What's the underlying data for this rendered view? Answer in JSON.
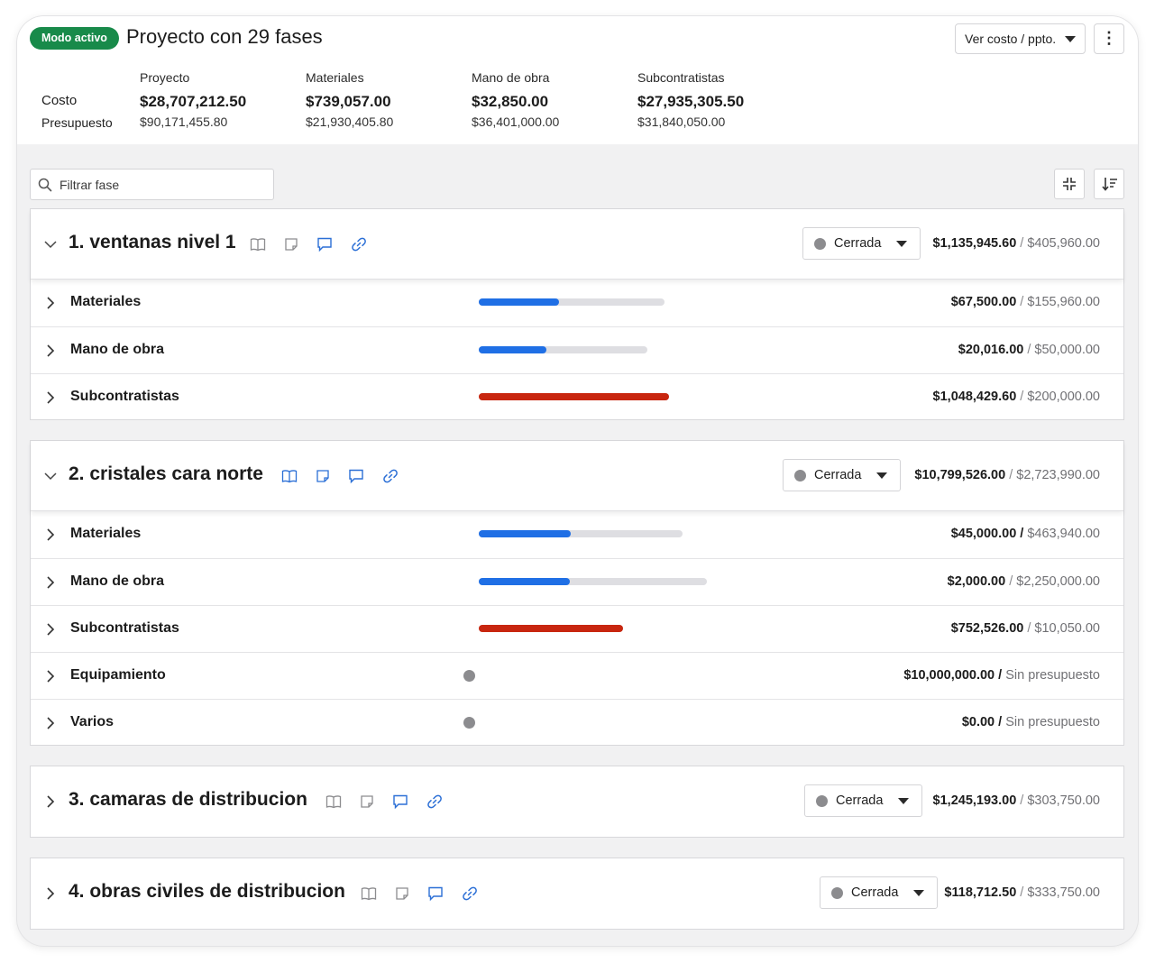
{
  "header": {
    "mode_badge": "Modo activo",
    "title": "Proyecto con 29 fases",
    "view_select": "Ver costo / ppto.",
    "more_icon": "kebab-vertical-icon"
  },
  "summary": {
    "cost_label": "Costo",
    "budget_label": "Presupuesto",
    "columns": [
      {
        "heading": "Proyecto",
        "cost": "$28,707,212.50",
        "budget": "$90,171,455.80"
      },
      {
        "heading": "Materiales",
        "cost": "$739,057.00",
        "budget": "$21,930,405.80"
      },
      {
        "heading": "Mano de obra",
        "cost": "$32,850.00",
        "budget": "$36,401,000.00"
      },
      {
        "heading": "Subcontratistas",
        "cost": "$27,935,305.50",
        "budget": "$31,840,050.00"
      }
    ]
  },
  "toolbar": {
    "filter_placeholder": "Filtrar fase",
    "collapse_icon": "collapse-all-icon",
    "sort_icon": "sort-icon"
  },
  "colors": {
    "active_badge": "#188a4a",
    "progress_blue": "#1f6fe5",
    "progress_over": "#c8260f",
    "icon_active": "#2b6fd6",
    "icon_inactive": "#8c8c8f"
  },
  "phases": [
    {
      "title": "1. ventanas nivel 1",
      "expanded": true,
      "status": "Cerrada",
      "cost": "$1,135,945.60",
      "separator": " / ",
      "budget": "$405,960.00",
      "icons_active": {
        "book": false,
        "note": false,
        "comment": true,
        "link": true
      },
      "rows": [
        {
          "label": "Materiales",
          "cost": "$67,500.00",
          "separator": " / ",
          "budget": "$155,960.00",
          "progress": 0.43,
          "over_budget": false
        },
        {
          "label": "Mano de obra",
          "cost": "$20,016.00",
          "separator": " / ",
          "budget": "$50,000.00",
          "progress": 0.4,
          "over_budget": false
        },
        {
          "label": "Subcontratistas",
          "cost": "$1,048,429.60",
          "separator": " / ",
          "budget": "$200,000.00",
          "progress": 1.0,
          "over_budget": true
        }
      ]
    },
    {
      "title": "2. cristales cara norte",
      "expanded": true,
      "status": "Cerrada",
      "cost": "$10,799,526.00",
      "separator": " / ",
      "budget": "$2,723,990.00",
      "icons_active": {
        "book": true,
        "note": true,
        "comment": true,
        "link": true
      },
      "rows": [
        {
          "label": "Materiales",
          "cost": "$45,000.00",
          "separator": " / ",
          "budget": "$463,940.00",
          "progress": 0.45,
          "over_budget": false
        },
        {
          "label": "Mano de obra",
          "cost": "$2,000.00",
          "separator": " / ",
          "budget": "$2,250,000.00",
          "progress": 0.4,
          "over_budget": false
        },
        {
          "label": "Subcontratistas",
          "cost": "$752,526.00",
          "separator": " / ",
          "budget": "$10,050.00",
          "progress": 1.0,
          "over_budget": true
        },
        {
          "label": "Equipamiento",
          "cost": "$10,000,000.00",
          "separator": " / ",
          "budget": "Sin presupuesto",
          "progress": null,
          "over_budget": false
        },
        {
          "label": "Varios",
          "cost": "$0.00",
          "separator": " / ",
          "budget": "Sin presupuesto",
          "progress": null,
          "over_budget": false
        }
      ]
    },
    {
      "title": "3. camaras de distribucion",
      "expanded": false,
      "status": "Cerrada",
      "cost": "$1,245,193.00",
      "separator": " / ",
      "budget": "$303,750.00",
      "icons_active": {
        "book": false,
        "note": false,
        "comment": true,
        "link": true
      },
      "rows": []
    },
    {
      "title": "4. obras civiles de distribucion",
      "expanded": false,
      "status": "Cerrada",
      "cost": "$118,712.50",
      "separator": " / ",
      "budget": "$333,750.00",
      "icons_active": {
        "book": false,
        "note": false,
        "comment": true,
        "link": true
      },
      "rows": []
    }
  ]
}
